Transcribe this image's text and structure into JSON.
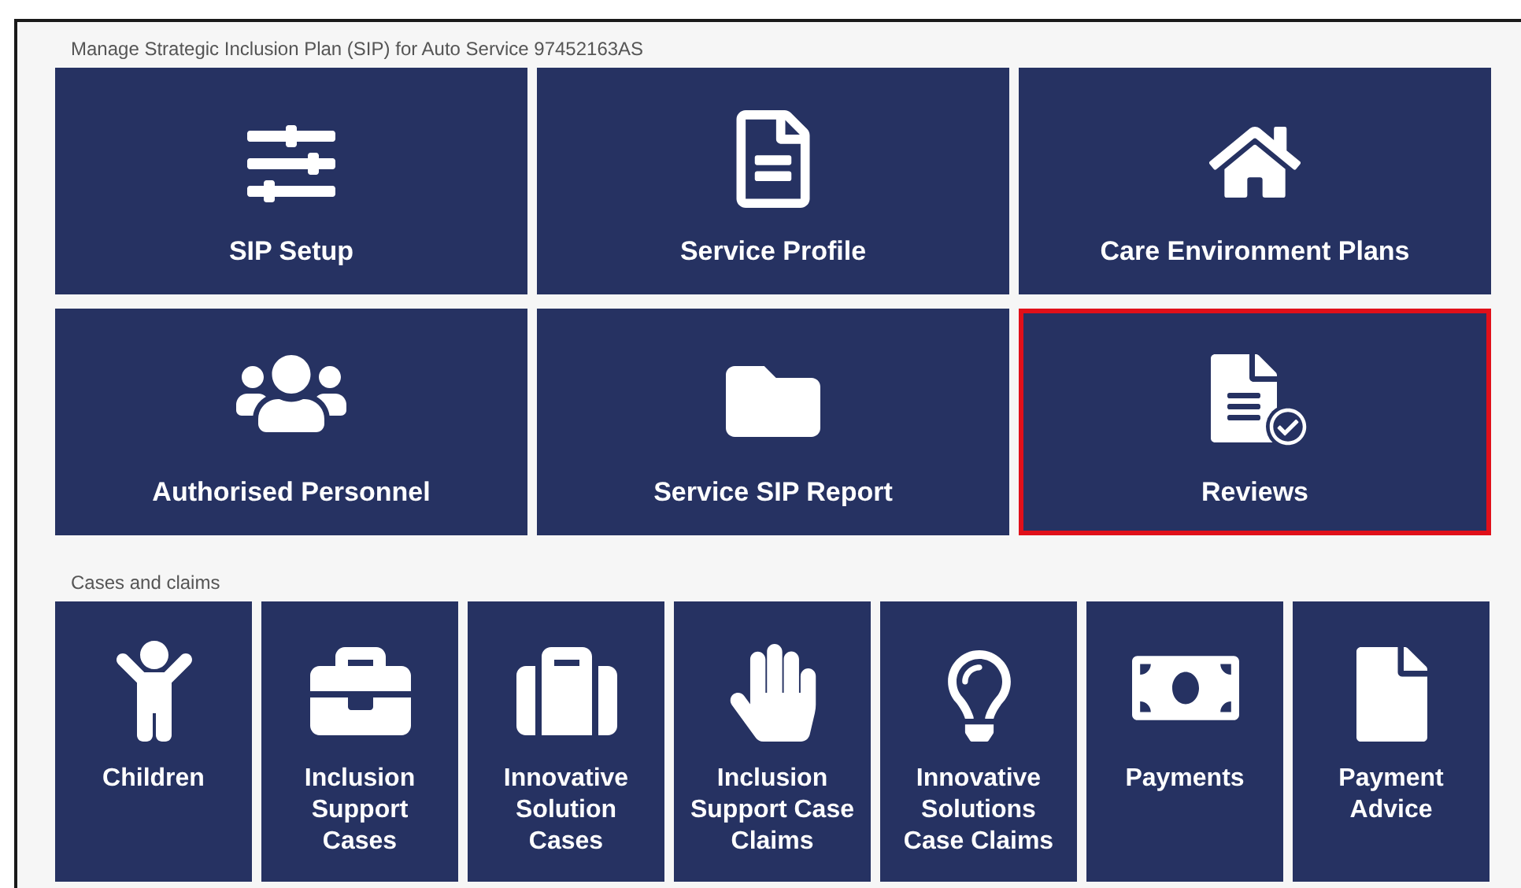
{
  "plan_section": {
    "title": "Manage Strategic Inclusion Plan (SIP) for Auto Service 97452163AS",
    "tiles": [
      {
        "label": "SIP Setup",
        "selected": false
      },
      {
        "label": "Service Profile",
        "selected": false
      },
      {
        "label": "Care Environment Plans",
        "selected": false
      },
      {
        "label": "Authorised Personnel",
        "selected": false
      },
      {
        "label": "Service SIP Report",
        "selected": false
      },
      {
        "label": "Reviews",
        "selected": true
      }
    ]
  },
  "cases_section": {
    "title": "Cases and claims",
    "tiles": [
      {
        "label": "Children"
      },
      {
        "label": "Inclusion Support Cases"
      },
      {
        "label": "Innovative Solution Cases"
      },
      {
        "label": "Inclusion Support Case Claims"
      },
      {
        "label": "Innovative Solutions Case Claims"
      },
      {
        "label": "Payments"
      },
      {
        "label": "Payment Advice"
      }
    ]
  }
}
